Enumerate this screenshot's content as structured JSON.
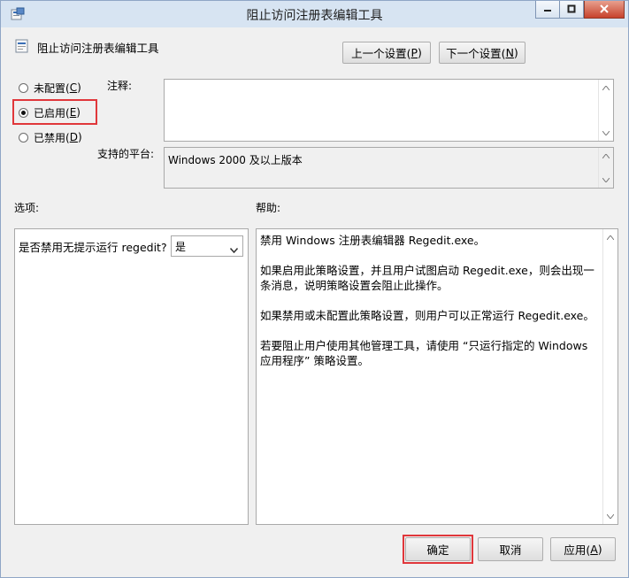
{
  "window": {
    "title": "阻止访问注册表编辑工具",
    "controls": {
      "minimize": "—",
      "maximize": "□",
      "close": "✕"
    }
  },
  "policy": {
    "name": "阻止访问注册表编辑工具",
    "icon": "policy-setting-icon"
  },
  "nav": {
    "prev_label": "上一个设置(",
    "prev_key": "P",
    "next_label": "下一个设置(",
    "next_key": "N",
    "close_paren": ")"
  },
  "state": {
    "options": [
      {
        "label": "未配置(",
        "key": "C",
        "selected": false
      },
      {
        "label": "已启用(",
        "key": "E",
        "selected": true
      },
      {
        "label": "已禁用(",
        "key": "D",
        "selected": false
      }
    ]
  },
  "comment": {
    "label": "注释:",
    "value": ""
  },
  "platform": {
    "label": "支持的平台:",
    "value": "Windows 2000 及以上版本"
  },
  "options_section": {
    "label": "选项:",
    "setting_label": "是否禁用无提示运行 regedit?",
    "setting_value": "是"
  },
  "help_section": {
    "label": "帮助:",
    "paragraphs": [
      "禁用 Windows 注册表编辑器 Regedit.exe。",
      "如果启用此策略设置，并且用户试图启动 Regedit.exe，则会出现一条消息，说明策略设置会阻止此操作。",
      "如果禁用或未配置此策略设置，则用户可以正常运行 Regedit.exe。",
      "若要阻止用户使用其他管理工具，请使用 “只运行指定的 Windows 应用程序” 策略设置。"
    ]
  },
  "footer": {
    "ok": "确定",
    "cancel": "取消",
    "apply_label": "应用(",
    "apply_key": "A",
    "close_paren": ")"
  },
  "colors": {
    "highlight": "#e0373b",
    "titlebar": "#d7e4f2",
    "close": "#c7422c"
  }
}
